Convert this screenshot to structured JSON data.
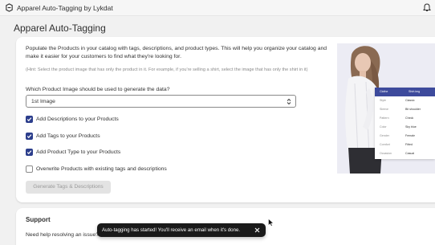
{
  "app": {
    "title": "Apparel Auto-Tagging by Lykdat"
  },
  "page": {
    "title": "Apparel Auto-Tagging"
  },
  "intro": {
    "description": "Populate the Products in your catalog with tags, descriptions, and product types. This will help you organize your catalog and make it easier for your customers to find what they're looking for.",
    "hint": "(Hint: Select the product image that has only the product in it. For example, if you're selling a shirt, select the image that has only the shirt in it)"
  },
  "image_select": {
    "label": "Which Product Image should be used to generate the data?",
    "value": "1st Image"
  },
  "options": [
    {
      "label": "Add Descriptions to your Products",
      "checked": true
    },
    {
      "label": "Add Tags to your Products",
      "checked": true
    },
    {
      "label": "Add Product Type to your Products",
      "checked": true
    },
    {
      "label": "Overwrite Products with existing tags and descriptions",
      "checked": false
    }
  ],
  "generate_button": {
    "label": "Generate Tags & Descriptions",
    "disabled": true
  },
  "preview_card": {
    "headers": [
      "Clothe",
      "Shirt.img"
    ],
    "rows": [
      {
        "key": "Style",
        "value": "Classic"
      },
      {
        "key": "Sleeve",
        "value": "Bit shoulder"
      },
      {
        "key": "Pattern",
        "value": "Check"
      },
      {
        "key": "Color",
        "value": "Sky blue"
      },
      {
        "key": "Gender",
        "value": "Female"
      },
      {
        "key": "Comfort",
        "value": "Fitted"
      },
      {
        "key": "Occasion",
        "value": "Casual"
      }
    ]
  },
  "support": {
    "title": "Support",
    "text": "Need help resolving an issue?"
  },
  "toast": {
    "message": "Auto-tagging has started! You'll receive an email when it's done."
  },
  "colors": {
    "accent": "#2c3e8c",
    "toast_bg": "#1a1a1a",
    "page_bg": "#f1f1f1",
    "card_header": "#3d4a9c"
  },
  "icons": [
    "app-icon",
    "bell-icon",
    "select-arrows-icon",
    "checkmark-icon",
    "close-icon",
    "cursor-icon"
  ]
}
